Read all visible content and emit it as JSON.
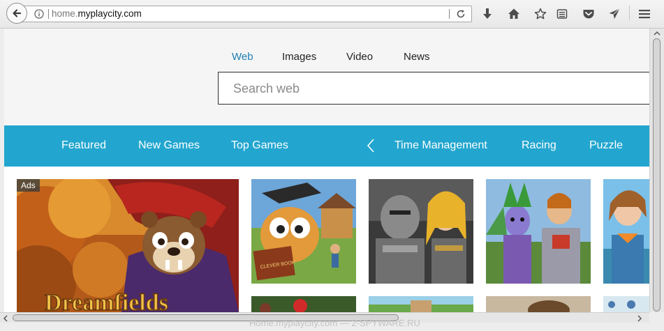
{
  "browser": {
    "url_prefix": "home.",
    "url_domain": "myplaycity.com",
    "icons": [
      "back-arrow-icon",
      "info-icon",
      "reload-icon",
      "download-icon",
      "home-icon",
      "bookmark-star-icon",
      "reading-list-icon",
      "pocket-icon",
      "send-icon",
      "hamburger-menu-icon"
    ]
  },
  "search": {
    "tabs": [
      {
        "label": "Web",
        "active": true
      },
      {
        "label": "Images",
        "active": false
      },
      {
        "label": "Video",
        "active": false
      },
      {
        "label": "News",
        "active": false
      }
    ],
    "placeholder": "Search web"
  },
  "categories": {
    "items": [
      "Featured",
      "New Games",
      "Top Games",
      "Time Management",
      "Racing",
      "Puzzle"
    ],
    "prev_icon": "chevron-left-icon"
  },
  "tiles": {
    "ads_label": "Ads",
    "featured_logo_text": "Dreamfields",
    "tile2_book_text": "CLEVER BOOK"
  },
  "watermark": "Home.myplaycity.com — 2-SPYWARE.RU",
  "colors": {
    "accent_tab": "#1e7eb3",
    "category_bar": "#22a6cf"
  }
}
